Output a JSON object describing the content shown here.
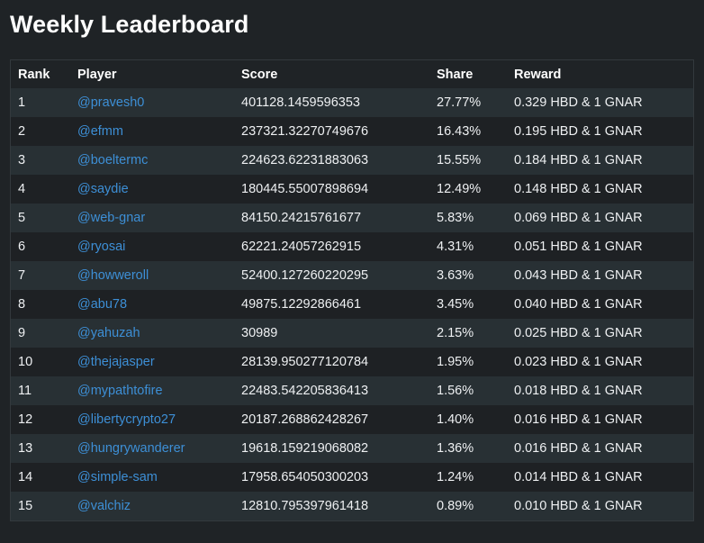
{
  "title": "Weekly Leaderboard",
  "table": {
    "headers": {
      "rank": "Rank",
      "player": "Player",
      "score": "Score",
      "share": "Share",
      "reward": "Reward"
    },
    "rows": [
      {
        "rank": "1",
        "player": "@pravesh0",
        "score": "401128.1459596353",
        "share": "27.77%",
        "reward": "0.329 HBD & 1 GNAR"
      },
      {
        "rank": "2",
        "player": "@efmm",
        "score": "237321.32270749676",
        "share": "16.43%",
        "reward": "0.195 HBD & 1 GNAR"
      },
      {
        "rank": "3",
        "player": "@boeltermc",
        "score": "224623.62231883063",
        "share": "15.55%",
        "reward": "0.184 HBD & 1 GNAR"
      },
      {
        "rank": "4",
        "player": "@saydie",
        "score": "180445.55007898694",
        "share": "12.49%",
        "reward": "0.148 HBD & 1 GNAR"
      },
      {
        "rank": "5",
        "player": "@web-gnar",
        "score": "84150.24215761677",
        "share": "5.83%",
        "reward": "0.069 HBD & 1 GNAR"
      },
      {
        "rank": "6",
        "player": "@ryosai",
        "score": "62221.24057262915",
        "share": "4.31%",
        "reward": "0.051 HBD & 1 GNAR"
      },
      {
        "rank": "7",
        "player": "@howweroll",
        "score": "52400.127260220295",
        "share": "3.63%",
        "reward": "0.043 HBD & 1 GNAR"
      },
      {
        "rank": "8",
        "player": "@abu78",
        "score": "49875.12292866461",
        "share": "3.45%",
        "reward": "0.040 HBD & 1 GNAR"
      },
      {
        "rank": "9",
        "player": "@yahuzah",
        "score": "30989",
        "share": "2.15%",
        "reward": "0.025 HBD & 1 GNAR"
      },
      {
        "rank": "10",
        "player": "@thejajasper",
        "score": "28139.950277120784",
        "share": "1.95%",
        "reward": "0.023 HBD & 1 GNAR"
      },
      {
        "rank": "11",
        "player": "@mypathtofire",
        "score": "22483.542205836413",
        "share": "1.56%",
        "reward": "0.018 HBD & 1 GNAR"
      },
      {
        "rank": "12",
        "player": "@libertycrypto27",
        "score": "20187.268862428267",
        "share": "1.40%",
        "reward": "0.016 HBD & 1 GNAR"
      },
      {
        "rank": "13",
        "player": "@hungrywanderer",
        "score": "19618.159219068082",
        "share": "1.36%",
        "reward": "0.016 HBD & 1 GNAR"
      },
      {
        "rank": "14",
        "player": "@simple-sam",
        "score": "17958.654050300203",
        "share": "1.24%",
        "reward": "0.014 HBD & 1 GNAR"
      },
      {
        "rank": "15",
        "player": "@valchiz",
        "score": "12810.795397961418",
        "share": "0.89%",
        "reward": "0.010 HBD & 1 GNAR"
      }
    ]
  },
  "colors": {
    "background": "#1f2326",
    "row_alt": "#283034",
    "link": "#3d8fd6"
  }
}
